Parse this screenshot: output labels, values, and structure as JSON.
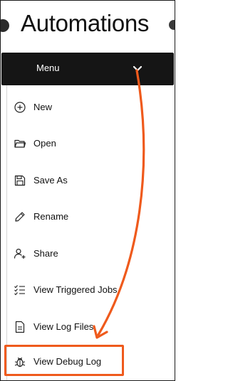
{
  "header": {
    "title": "Automations"
  },
  "menu": {
    "label": "Menu",
    "toggle_icon": "chevron-down-icon",
    "items": [
      {
        "label": "New",
        "icon": "plus-circle-icon"
      },
      {
        "label": "Open",
        "icon": "folder-icon"
      },
      {
        "label": "Save As",
        "icon": "save-icon"
      },
      {
        "label": "Rename",
        "icon": "pencil-icon"
      },
      {
        "label": "Share",
        "icon": "add-user-icon"
      },
      {
        "label": "View Triggered Jobs",
        "icon": "checklist-icon"
      },
      {
        "label": "View Log Files",
        "icon": "file-icon"
      },
      {
        "label": "View Debug Log",
        "icon": "bug-icon"
      }
    ]
  },
  "annotation": {
    "color": "#ef5a1c",
    "target": "View Debug Log"
  },
  "colors": {
    "menu_bar_bg": "#151515",
    "menu_bar_text": "#ffffff",
    "highlight": "#ef5a1c"
  }
}
